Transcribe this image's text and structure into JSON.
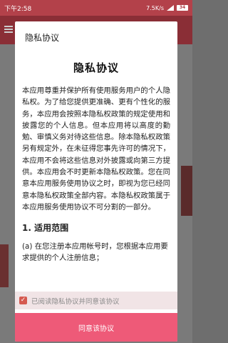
{
  "status_bar": {
    "time": "下午2:58",
    "network_speed": "7.5K/s",
    "battery": "34"
  },
  "dialog": {
    "title": "隐私协议",
    "heading": "隐私协议",
    "paragraph": "本应用尊重并保护所有使用服务用户的个人隐私权。为了给您提供更准确、更有个性化的服务，本应用会按照本隐私权政策的规定使用和披露您的个人信息。但本应用将以高度的勤勉、审慎义务对待这些信息。除本隐私权政策另有规定外，在未征得您事先许可的情况下，本应用不会将这些信息对外披露或向第三方提供。本应用会不时更新本隐私权政策。您在同意本应用服务使用协议之时，即视为您已经同意本隐私权政策全部内容。本隐私权政策属于本应用服务使用协议不可分割的一部分。",
    "section_1_heading": "1. 适用范围",
    "section_1_text": "(a) 在您注册本应用帐号时，您根据本应用要求提供的个人注册信息；",
    "checkbox_label": "已阅读隐私协议并同意该协议",
    "checkbox_checked": true,
    "agree_button": "同意该协议"
  },
  "colors": {
    "status_bar": "#b3414a",
    "button": "#ee5a78",
    "checkbox": "#d55a50",
    "checkbox_row": "#f1e4e6"
  }
}
